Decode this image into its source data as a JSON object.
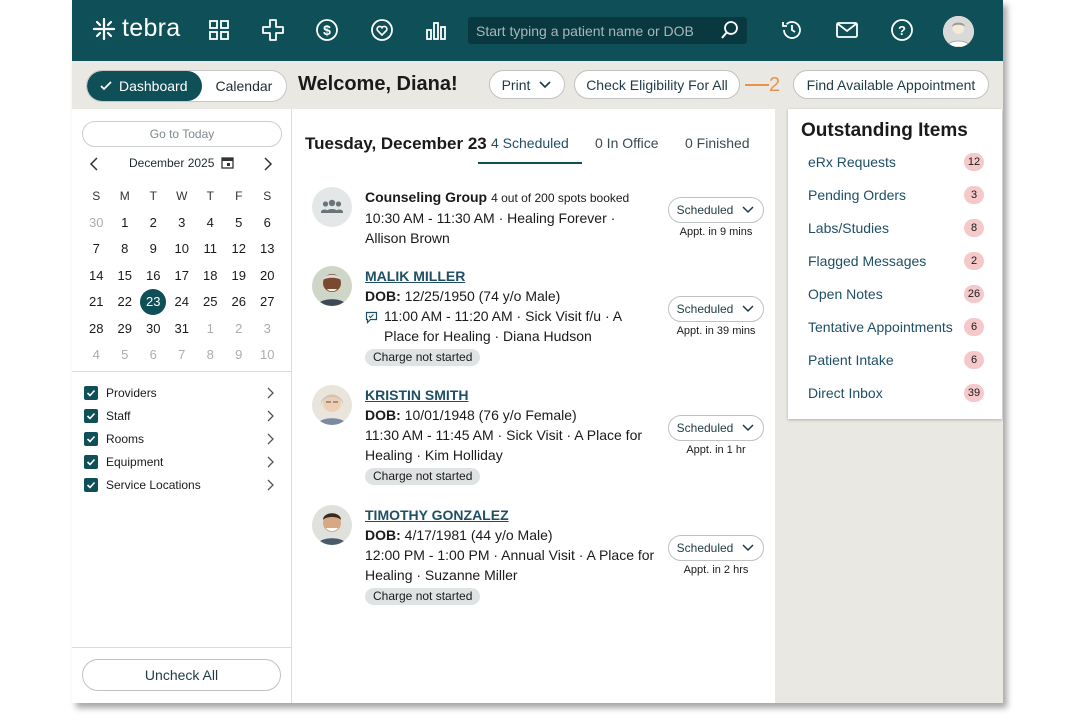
{
  "app": {
    "logo_text": "tebra"
  },
  "header": {
    "search_placeholder": "Start typing a patient name or DOB",
    "icons": [
      "apps-grid-icon",
      "plus-cross-icon",
      "dollar-icon",
      "heart-shield-icon",
      "bar-chart-icon",
      "history-icon",
      "mail-icon",
      "help-icon"
    ]
  },
  "subheader": {
    "dashboard_label": "Dashboard",
    "calendar_label": "Calendar",
    "welcome": "Welcome, Diana!",
    "print_label": "Print",
    "eligibility_label": "Check Eligibility For All",
    "annotation_number": "2",
    "find_appt_label": "Find Available Appointment"
  },
  "left": {
    "go_today": "Go to Today",
    "month_label": "December 2025",
    "weekdays": [
      "S",
      "M",
      "T",
      "W",
      "T",
      "F",
      "S"
    ],
    "weeks": [
      [
        "30",
        "1",
        "2",
        "3",
        "4",
        "5",
        "6"
      ],
      [
        "7",
        "8",
        "9",
        "10",
        "11",
        "12",
        "13"
      ],
      [
        "14",
        "15",
        "16",
        "17",
        "18",
        "19",
        "20"
      ],
      [
        "21",
        "22",
        "23",
        "24",
        "25",
        "26",
        "27"
      ],
      [
        "28",
        "29",
        "30",
        "31",
        "1",
        "2",
        "3"
      ],
      [
        "4",
        "5",
        "6",
        "7",
        "8",
        "9",
        "10"
      ]
    ],
    "selected_day": "23",
    "filters": [
      "Providers",
      "Staff",
      "Rooms",
      "Equipment",
      "Service Locations"
    ],
    "uncheck_all": "Uncheck All"
  },
  "middle": {
    "date_title": "Tuesday, December 23",
    "tabs": [
      "4 Scheduled",
      "0 In Office",
      "0 Finished"
    ],
    "appointments": [
      {
        "group_name": "Counseling Group",
        "group_sub": "4 out of 200 spots booked",
        "line1": "10:30 AM - 11:30 AM · Healing Forever · Allison Brown",
        "status": "Scheduled",
        "note": "Appt. in 9 mins"
      },
      {
        "name": "MALIK MILLER",
        "dob_label": "DOB:",
        "dob": "12/25/1950 (74 y/o Male)",
        "line1": "11:00 AM - 11:20 AM · Sick Visit f/u · A Place for Healing · Diana Hudson",
        "charge": "Charge not started",
        "status": "Scheduled",
        "note": "Appt. in 39 mins"
      },
      {
        "name": "KRISTIN SMITH",
        "dob_label": "DOB:",
        "dob": "10/01/1948 (76 y/o Female)",
        "line1": "11:30 AM - 11:45 AM · Sick Visit · A Place for Healing · Kim Holliday",
        "charge": "Charge not started",
        "status": "Scheduled",
        "note": "Appt. in 1 hr"
      },
      {
        "name": "TIMOTHY GONZALEZ",
        "dob_label": "DOB:",
        "dob": "4/17/1981 (44 y/o Male)",
        "line1": "12:00 PM - 1:00 PM · Annual Visit · A Place for Healing · Suzanne Miller",
        "charge": "Charge not started",
        "status": "Scheduled",
        "note": "Appt. in 2 hrs"
      }
    ]
  },
  "outstanding": {
    "title": "Outstanding Items",
    "items": [
      {
        "label": "eRx Requests",
        "count": "12"
      },
      {
        "label": "Pending Orders",
        "count": "3"
      },
      {
        "label": "Labs/Studies",
        "count": "8"
      },
      {
        "label": "Flagged Messages",
        "count": "2"
      },
      {
        "label": "Open Notes",
        "count": "26"
      },
      {
        "label": "Tentative Appointments",
        "count": "6"
      },
      {
        "label": "Patient Intake",
        "count": "6"
      },
      {
        "label": "Direct Inbox",
        "count": "39"
      }
    ]
  },
  "colors": {
    "brand": "#0f4f57",
    "annotation": "#e8924a",
    "badge": "#f5c9c9",
    "panel_bg": "#eae8e2"
  }
}
